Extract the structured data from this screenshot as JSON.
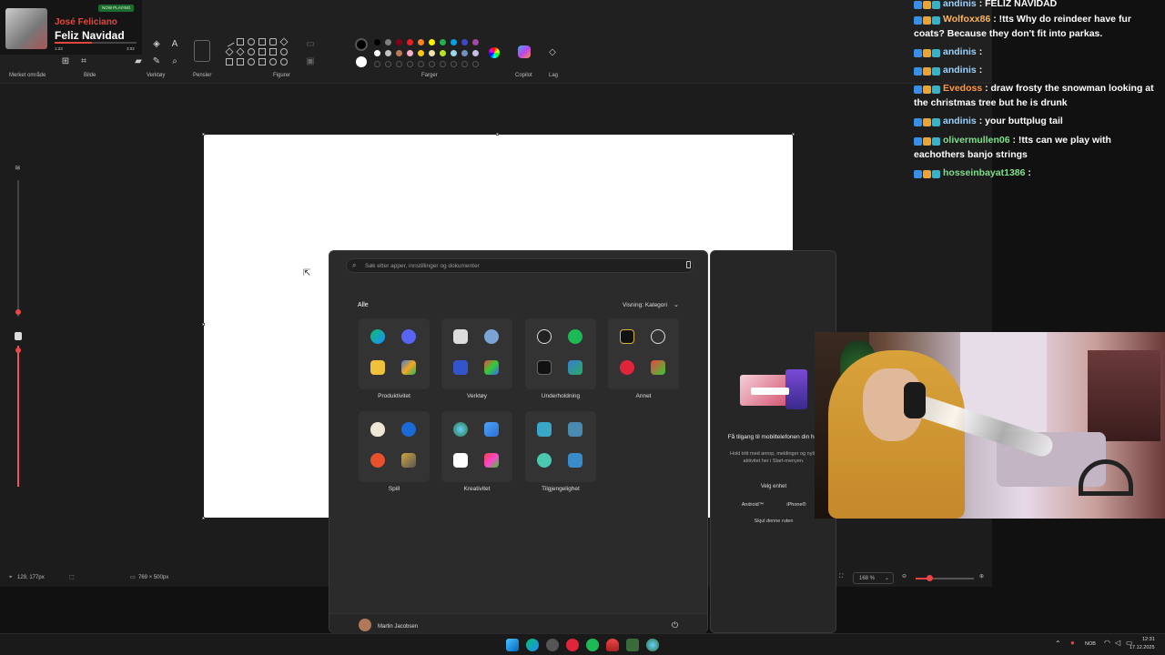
{
  "now_playing": {
    "badge": "NOW PLAYING",
    "artist": "José Feliciano",
    "title": "Feliz Navidad",
    "elapsed": "1:23",
    "duration": "3:02",
    "progress": 0.45
  },
  "ribbon": {
    "groups": [
      "Merket område",
      "Bilde",
      "Verktøy",
      "Pensler",
      "Figurer",
      "Farger",
      "Copilot",
      "Lag"
    ],
    "colors_row1": [
      "#000000",
      "#7f7f7f",
      "#880015",
      "#ed1c24",
      "#ff7f27",
      "#fff200",
      "#22b14c",
      "#00a2e8",
      "#3f48cc",
      "#a349a4"
    ],
    "colors_row2": [
      "#ffffff",
      "#c3c3c3",
      "#b97a57",
      "#ffaec9",
      "#ffc90e",
      "#efe4b0",
      "#b5e61d",
      "#99d9ea",
      "#7092be",
      "#c8bfe7"
    ]
  },
  "status": {
    "cursor_pos": "129, 177px",
    "canvas_size": "769 × 500px",
    "zoom": "168 %"
  },
  "start_menu": {
    "search_placeholder": "Søk etter apper, innstillinger og dokumenter",
    "section": "Alle",
    "view_label": "Visning: Kategori",
    "folders": [
      "Produktivitet",
      "Verktøy",
      "Underholdning",
      "Annet",
      "Spill",
      "Kreativitet",
      "Tilgjengelighet"
    ],
    "user": "Martin Jacobsen"
  },
  "phone_panel": {
    "title": "Få tilgang til mobiltelefonen din her",
    "body": "Hold tritt med anrop, meldinger og nylig aktivitet her i Start-menyen.",
    "choose": "Velg enhet",
    "android": "Android™",
    "iphone": "iPhone®",
    "hide": "Skjul denne ruten"
  },
  "chat": [
    {
      "user": "andinis",
      "color": "#9ad3ff",
      "msg": ": FELIZ NAVIDAD"
    },
    {
      "user": "Wolfoxx86",
      "color": "#ffb45e",
      "msg": ": !tts Why do reindeer have fur coats? Because they don't fit into parkas."
    },
    {
      "user": "andinis",
      "color": "#9ad3ff",
      "msg": ":"
    },
    {
      "user": "andinis",
      "color": "#9ad3ff",
      "msg": ":"
    },
    {
      "user": "Evedoss",
      "color": "#ff9a3c",
      "msg": ": draw frosty the snowman looking at the christmas tree but he is drunk"
    },
    {
      "user": "andinis",
      "color": "#9ad3ff",
      "msg": ": your buttplug tail"
    },
    {
      "user": "olivermullen06",
      "color": "#7de08a",
      "msg": ": !tts can we play with eachothers banjo strings"
    },
    {
      "user": "hosseinbayat1386",
      "color": "#7de08a",
      "msg": ":"
    }
  ],
  "tray": {
    "lang": "NOB",
    "time": "12:31",
    "date": "17.12.2025"
  }
}
